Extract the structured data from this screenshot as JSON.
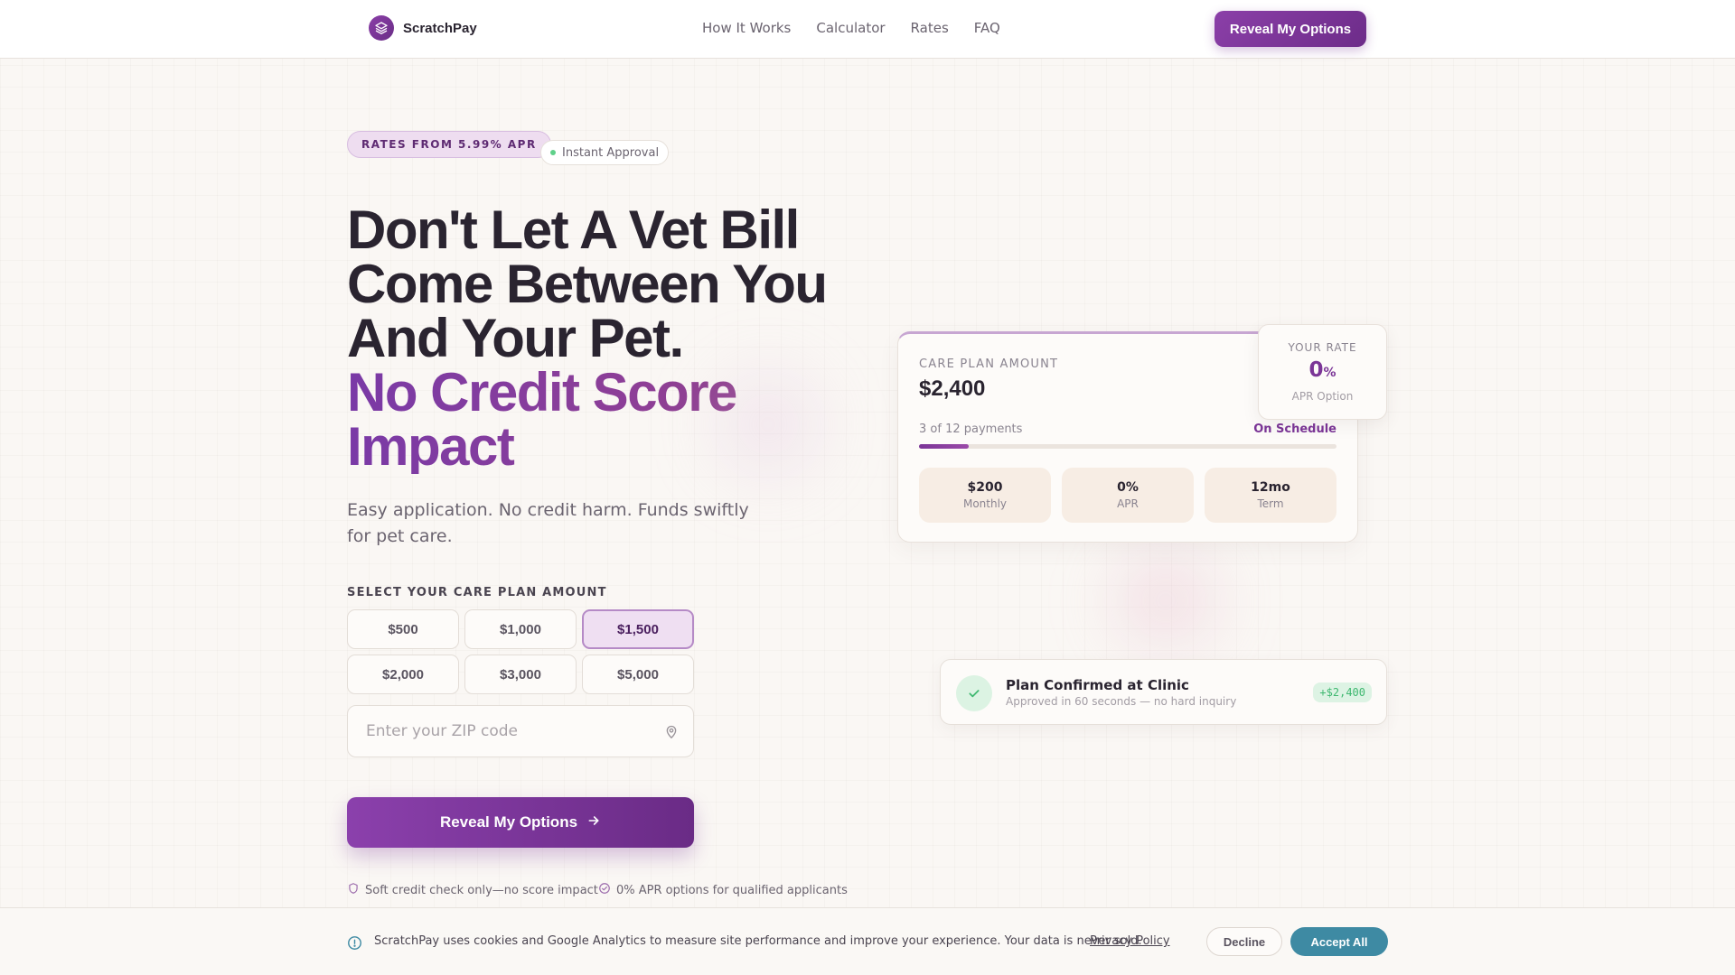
{
  "brand": {
    "name": "ScratchPay",
    "logo_icon": "layers-icon",
    "accent": "#7b3597",
    "accent_alt": "#3e8aa3"
  },
  "nav": {
    "items": [
      {
        "label": "How It Works"
      },
      {
        "label": "Calculator"
      },
      {
        "label": "Rates"
      },
      {
        "label": "FAQ"
      }
    ],
    "cta_label": "Reveal My Options"
  },
  "hero": {
    "badge_rates": "RATES FROM 5.99% APR",
    "badge_instant": "Instant Approval",
    "headline_line1": "Don't Let A Vet Bill",
    "headline_line2": "Come Between You",
    "headline_line3": "And Your Pet.",
    "headline_accent_line1": "No Credit Score",
    "headline_accent_line2": "Impact",
    "subhead": "Easy application. No credit harm. Funds swiftly for pet care."
  },
  "form": {
    "select_label": "SELECT YOUR CARE PLAN AMOUNT",
    "amounts": [
      "$500",
      "$1,000",
      "$1,500",
      "$2,000",
      "$3,000",
      "$5,000"
    ],
    "selected_amount": "$1,500",
    "zip_placeholder": "Enter your ZIP code",
    "zip_value": "",
    "zip_icon": "map-pin-icon",
    "submit_label": "Reveal My Options",
    "submit_icon": "arrow-right-icon"
  },
  "trust": [
    {
      "icon": "shield-icon",
      "label": "Soft credit check only—no score impact"
    },
    {
      "icon": "check-circle-icon",
      "label": "0% APR options for qualified applicants"
    }
  ],
  "plan_card": {
    "label": "CARE PLAN AMOUNT",
    "amount": "$2,400",
    "progress_text": "3 of 12 payments",
    "progress_fraction": 0.12,
    "status": "On Schedule",
    "stats": [
      {
        "value": "$200",
        "label": "Monthly"
      },
      {
        "value": "0%",
        "label": "APR"
      },
      {
        "value": "12mo",
        "label": "Term"
      }
    ]
  },
  "rate_card": {
    "label": "YOUR RATE",
    "value": "0",
    "unit": "%",
    "sub": "APR Option"
  },
  "confirm_card": {
    "icon": "check-icon",
    "title": "Plan Confirmed at Clinic",
    "subtitle": "Approved in 60 seconds — no hard inquiry",
    "chip": "+$2,400"
  },
  "cookie": {
    "icon": "info-icon",
    "text": "ScratchPay uses cookies and Google Analytics to measure site performance and improve your experience. Your data is never sold.",
    "link_label": "Privacy Policy",
    "decline_label": "Decline",
    "accept_label": "Accept All"
  }
}
